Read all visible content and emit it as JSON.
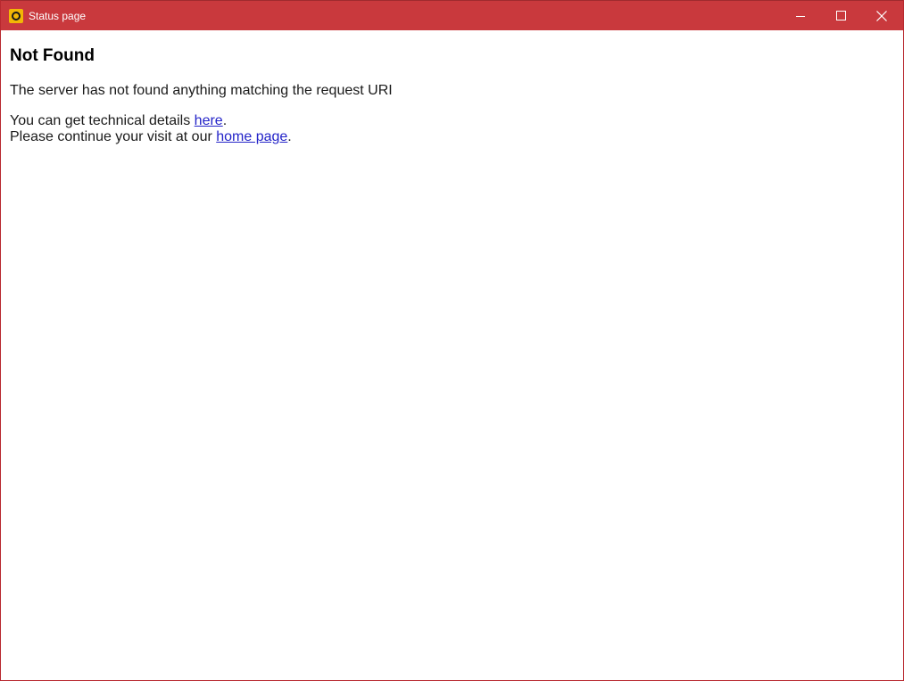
{
  "window": {
    "title": "Status page",
    "app_icon": "status-app-icon",
    "controls": {
      "minimize_icon": "minimize-icon",
      "maximize_icon": "maximize-icon",
      "close_icon": "close-icon"
    },
    "titlebar_color": "#c9393d"
  },
  "page": {
    "heading": "Not Found",
    "message": "The server has not found anything matching the request URI",
    "details_prefix": "You can get technical details ",
    "details_link": "here",
    "details_suffix": ".",
    "continue_prefix": "Please continue your visit at our ",
    "continue_link": "home page",
    "continue_suffix": ".",
    "link_color": "#2323c8"
  }
}
